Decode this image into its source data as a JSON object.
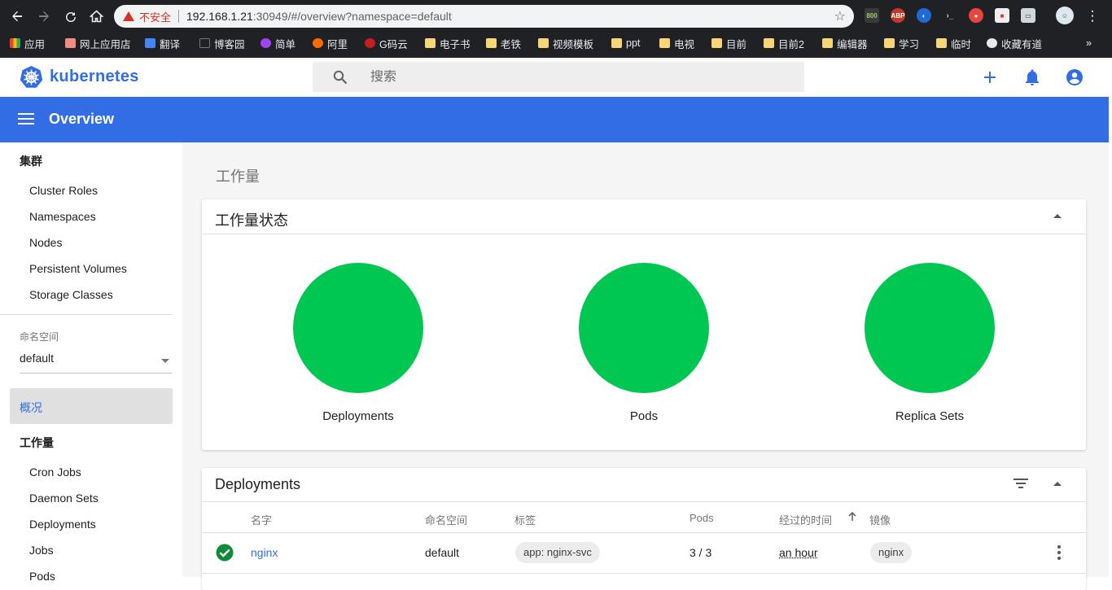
{
  "browser": {
    "security_label": "不安全",
    "url_host": "192.168.1.21",
    "url_rest": ":30949/#/overview?namespace=default",
    "bookmarks": [
      "应用",
      "网上应用店",
      "翻译",
      "博客园",
      "简单",
      "阿里",
      "G码云",
      "电子书",
      "老铁",
      "视频模板",
      "ppt",
      "电视",
      "目前",
      "目前2",
      "编辑器",
      "学习",
      "临时",
      "收藏有道"
    ],
    "more_bookmarks": "»"
  },
  "header": {
    "logo_text": "kubernetes",
    "search_placeholder": "搜索"
  },
  "toolbar": {
    "title": "Overview"
  },
  "sidebar": {
    "cluster_label": "集群",
    "cluster_items": [
      "Cluster Roles",
      "Namespaces",
      "Nodes",
      "Persistent Volumes",
      "Storage Classes"
    ],
    "namespace_label": "命名空间",
    "namespace_value": "default",
    "overview_label": "概况",
    "workloads_label": "工作量",
    "workload_items": [
      "Cron Jobs",
      "Daemon Sets",
      "Deployments",
      "Jobs",
      "Pods"
    ]
  },
  "main": {
    "page_title": "工作量",
    "status_card": {
      "title": "工作量状态",
      "items": [
        "Deployments",
        "Pods",
        "Replica Sets"
      ],
      "status_color": "#00c752"
    },
    "deployments_card": {
      "title": "Deployments",
      "columns": [
        "名字",
        "命名空间",
        "标签",
        "Pods",
        "经过的时间",
        "镜像"
      ],
      "rows": [
        {
          "name": "nginx",
          "namespace": "default",
          "labels": "app: nginx-svc",
          "pods": "3 / 3",
          "age": "an hour",
          "image": "nginx",
          "status": "ok"
        }
      ]
    }
  },
  "colors": {
    "accent": "#326de6",
    "success": "#00c752"
  }
}
